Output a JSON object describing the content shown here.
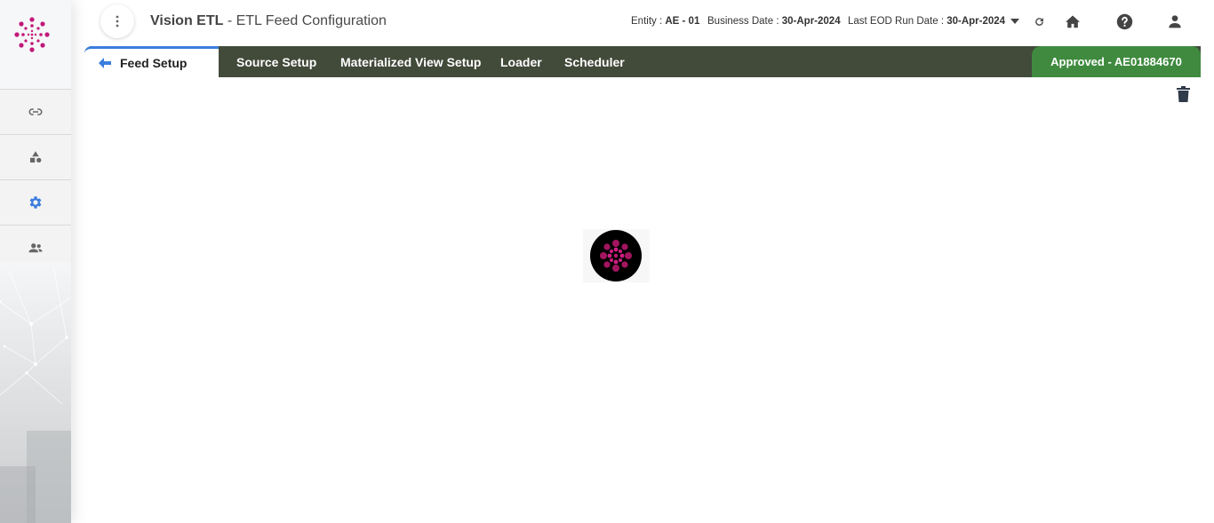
{
  "header": {
    "brand": "Vision ETL",
    "subtitle": " - ETL Feed Configuration",
    "entity_label": "Entity :",
    "entity_value": "AE - 01",
    "business_date_label": "Business Date :",
    "business_date_value": "30-Apr-2024",
    "eod_label": "Last EOD Run Date :",
    "eod_value": "30-Apr-2024",
    "icons": [
      "more-vert-icon",
      "chevron-down-icon",
      "refresh-icon",
      "home-icon",
      "help-icon",
      "user-icon"
    ]
  },
  "sidebar": {
    "items": [
      {
        "icon": "link-icon",
        "active": false
      },
      {
        "icon": "shapes-icon",
        "active": false
      },
      {
        "icon": "gear-icon",
        "active": true
      },
      {
        "icon": "users-icon",
        "active": false
      }
    ]
  },
  "tabs": [
    {
      "label": "Feed Setup",
      "active": true
    },
    {
      "label": "Source Setup",
      "active": false
    },
    {
      "label": "Materialized View Setup",
      "active": false
    },
    {
      "label": "Loader",
      "active": false
    },
    {
      "label": "Scheduler",
      "active": false
    }
  ],
  "status": {
    "label": "Approved - AE01884670",
    "color": "#3f8a3f"
  },
  "colors": {
    "accent": "#3b7ddd",
    "tabbar": "#424a3a",
    "logo": "#c2187a"
  }
}
